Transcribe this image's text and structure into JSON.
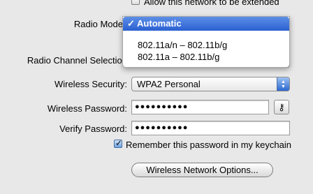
{
  "extend_network": {
    "label": "Allow this network to be extended",
    "checked": false
  },
  "radio_mode": {
    "label": "Radio Mode",
    "selected": "Automatic",
    "checkmark": "✓",
    "options": [
      "802.11a/n – 802.11b/g",
      "802.11a – 802.11b/g"
    ]
  },
  "radio_channel": {
    "label": "Radio Channel Selection"
  },
  "wireless_security": {
    "label": "Wireless Security:",
    "value": "WPA2 Personal"
  },
  "wireless_password": {
    "label": "Wireless Password:",
    "value": "●●●●●●●●●●"
  },
  "verify_password": {
    "label": "Verify Password:",
    "value": "●●●●●●●●●●"
  },
  "remember_password": {
    "label": "Remember this password in my keychain",
    "checked": true
  },
  "options_button": {
    "label": "Wireless Network Options..."
  },
  "icons": {
    "key": "key-icon",
    "updown": "updown-arrows-icon",
    "check": "checkmark-icon"
  },
  "colors": {
    "selection": "#2a5fd1",
    "background": "#e8e8e8"
  }
}
